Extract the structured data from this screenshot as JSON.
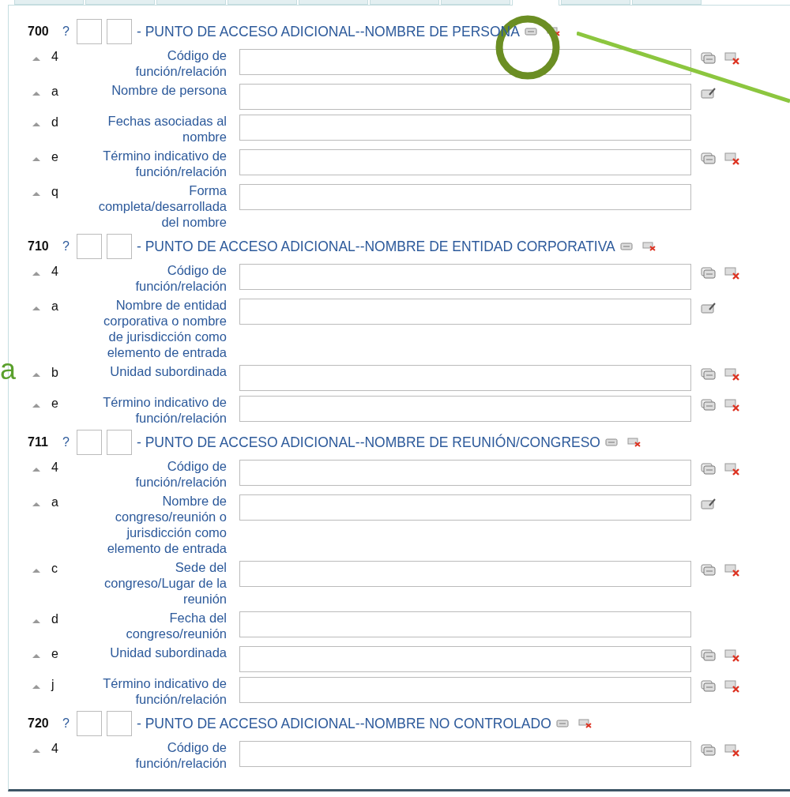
{
  "tabs": [
    {
      "selected": false
    },
    {
      "selected": false
    },
    {
      "selected": false
    },
    {
      "selected": false
    },
    {
      "selected": false
    },
    {
      "selected": false
    },
    {
      "selected": false
    },
    {
      "selected": true
    },
    {
      "selected": false
    },
    {
      "selected": false
    }
  ],
  "fields": [
    {
      "tag": "700",
      "help": "?",
      "title": "- PUNTO DE ACCESO ADICIONAL--NOMBRE DE PERSONA",
      "subfields": [
        {
          "code": "4",
          "label": "Código de función/relación",
          "kind": "repeat"
        },
        {
          "code": "a",
          "label": "Nombre de persona",
          "kind": "edit"
        },
        {
          "code": "d",
          "label": "Fechas asociadas al nombre",
          "kind": "plain"
        },
        {
          "code": "e",
          "label": "Término indicativo de función/relación",
          "kind": "repeat"
        },
        {
          "code": "q",
          "label": "Forma completa/desarrollada del nombre",
          "kind": "plain"
        }
      ]
    },
    {
      "tag": "710",
      "help": "?",
      "title": "- PUNTO DE ACCESO ADICIONAL--NOMBRE DE ENTIDAD CORPORATIVA",
      "subfields": [
        {
          "code": "4",
          "label": "Código de función/relación",
          "kind": "repeat"
        },
        {
          "code": "a",
          "label": "Nombre de entidad corporativa o nombre de jurisdicción como elemento de entrada",
          "kind": "edit"
        },
        {
          "code": "b",
          "label": "Unidad subordinada",
          "kind": "repeat"
        },
        {
          "code": "e",
          "label": "Término indicativo de función/relación",
          "kind": "repeat"
        }
      ]
    },
    {
      "tag": "711",
      "help": "?",
      "title": "- PUNTO DE ACCESO ADICIONAL--NOMBRE DE REUNIÓN/CONGRESO",
      "subfields": [
        {
          "code": "4",
          "label": "Código de función/relación",
          "kind": "repeat"
        },
        {
          "code": "a",
          "label": "Nombre de congreso/reunión o jurisdicción como elemento de entrada",
          "kind": "edit"
        },
        {
          "code": "c",
          "label": "Sede del congreso/Lugar de la reunión",
          "kind": "repeat"
        },
        {
          "code": "d",
          "label": "Fecha del congreso/reunión",
          "kind": "plain"
        },
        {
          "code": "e",
          "label": "Unidad subordinada",
          "kind": "repeat"
        },
        {
          "code": "j",
          "label": "Término indicativo de función/relación",
          "kind": "repeat"
        }
      ]
    },
    {
      "tag": "720",
      "help": "?",
      "title": "- PUNTO DE ACCESO ADICIONAL--NOMBRE NO CONTROLADO",
      "subfields": [
        {
          "code": "4",
          "label": "Código de función/relación",
          "kind": "repeat"
        }
      ]
    }
  ],
  "annotation": {
    "letter": "a"
  }
}
